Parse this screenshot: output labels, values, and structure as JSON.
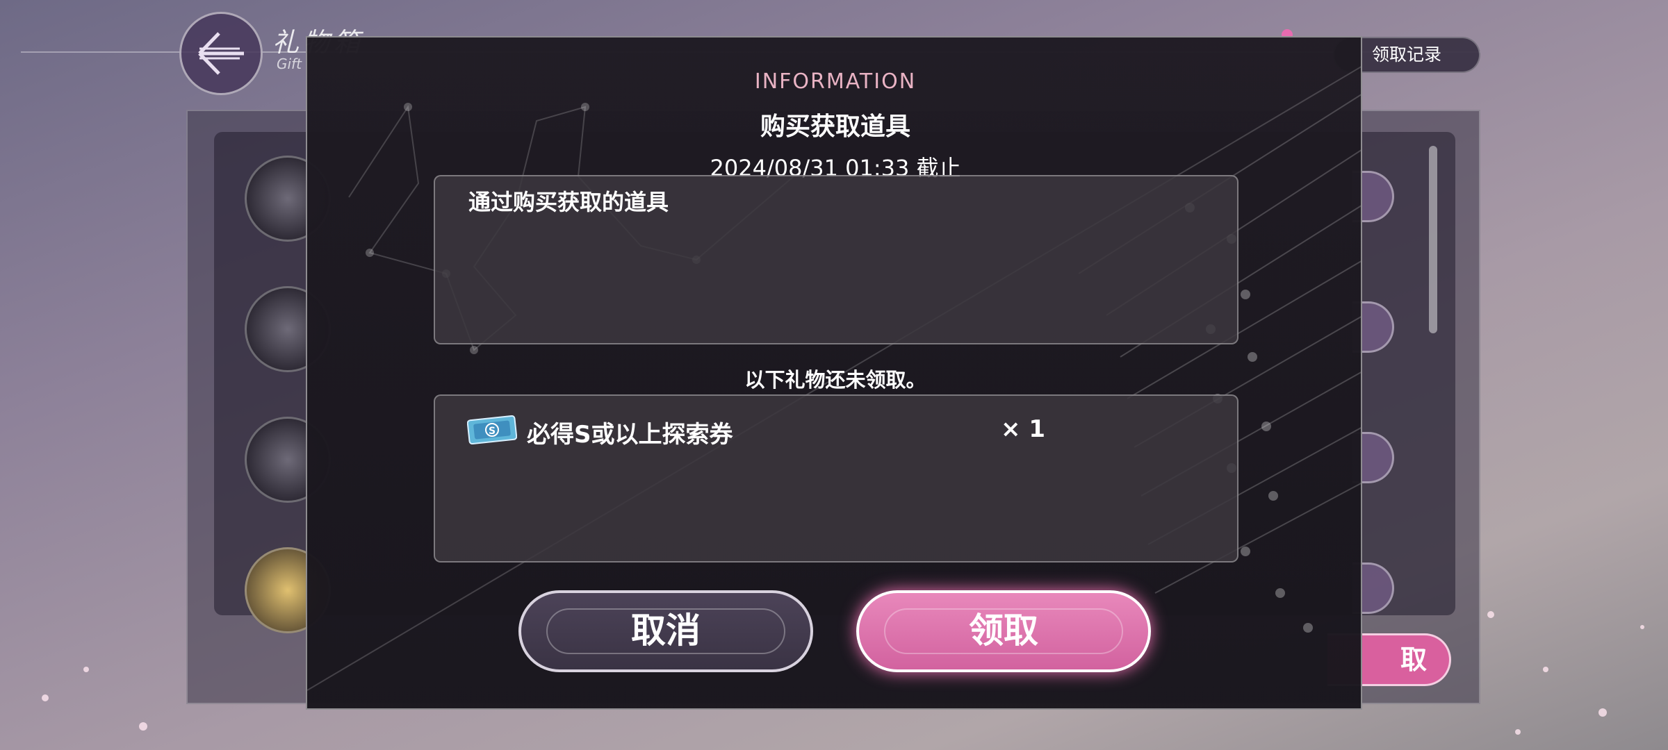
{
  "background": {
    "title": "礼物箱",
    "subtitle": "Gift",
    "history_button": "领取记录",
    "claim_all_button": "取"
  },
  "modal": {
    "label": "INFORMATION",
    "title": "购买获取道具",
    "deadline": "2024/08/31 01:33 截止",
    "description": "通过购买获取的道具",
    "unclaimed_label": "以下礼物还未领取。",
    "items": [
      {
        "icon": "ticket-icon",
        "name": "必得S或以上探索券",
        "quantity": "× 1"
      }
    ],
    "cancel_label": "取消",
    "confirm_label": "领取"
  },
  "colors": {
    "accent_pink": "#d2629f",
    "label_pink": "#e9b3c4",
    "modal_bg": "#1e1a22"
  }
}
